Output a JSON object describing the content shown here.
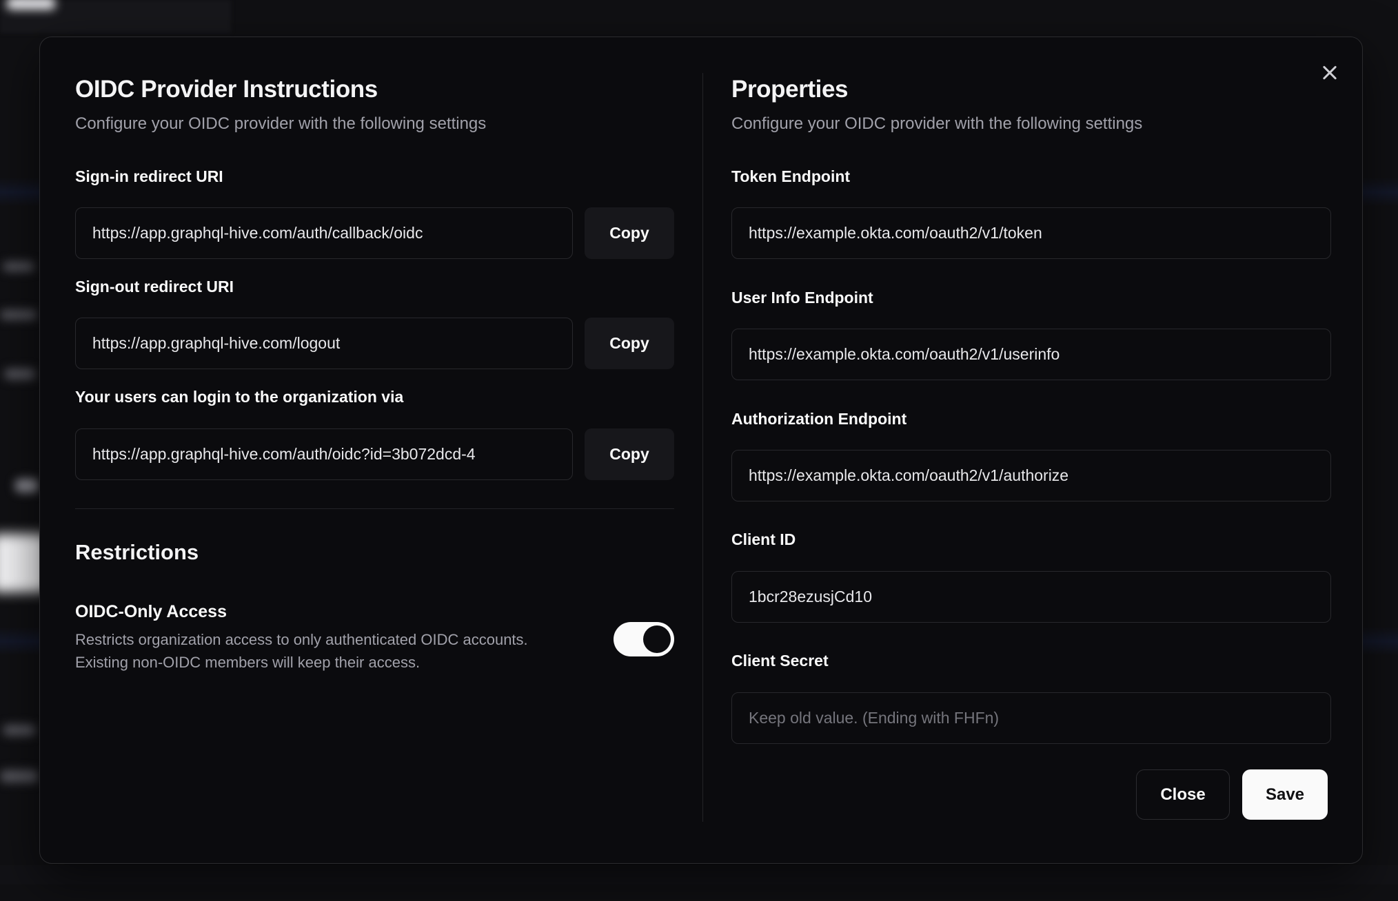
{
  "dialog": {
    "close_icon": "x",
    "left": {
      "title": "OIDC Provider Instructions",
      "subtitle": "Configure your OIDC provider with the following settings",
      "fields": [
        {
          "label": "Sign-in redirect URI",
          "value": "https://app.graphql-hive.com/auth/callback/oidc",
          "button": "Copy"
        },
        {
          "label": "Sign-out redirect URI",
          "value": "https://app.graphql-hive.com/logout",
          "button": "Copy"
        },
        {
          "label": "Your users can login to the organization via",
          "value": "https://app.graphql-hive.com/auth/oidc?id=3b072dcd-4",
          "button": "Copy"
        }
      ],
      "restrictions": {
        "title": "Restrictions",
        "toggle_label": "OIDC-Only Access",
        "description_line1": "Restricts organization access to only authenticated OIDC accounts.",
        "description_line2": "Existing non-OIDC members will keep their access.",
        "toggle_state": "on"
      }
    },
    "right": {
      "title": "Properties",
      "subtitle": "Configure your OIDC provider with the following settings",
      "fields": [
        {
          "label": "Token Endpoint",
          "value": "https://example.okta.com/oauth2/v1/token"
        },
        {
          "label": "User Info Endpoint",
          "value": "https://example.okta.com/oauth2/v1/userinfo"
        },
        {
          "label": "Authorization Endpoint",
          "value": "https://example.okta.com/oauth2/v1/authorize"
        },
        {
          "label": "Client ID",
          "value": "1bcr28ezusjCd10"
        },
        {
          "label": "Client Secret",
          "value": "",
          "placeholder": "Keep old value. (Ending with FHFn)"
        }
      ],
      "buttons": {
        "close": "Close",
        "save": "Save"
      }
    },
    "colors": {
      "page_bg": "#101013",
      "modal_bg": "#0b0b0e",
      "border": "#28282c",
      "muted_text": "#a1a1aa",
      "save_button_bg": "#fafafa",
      "save_button_text": "#111113",
      "toggle_on": "#fafafa"
    }
  }
}
